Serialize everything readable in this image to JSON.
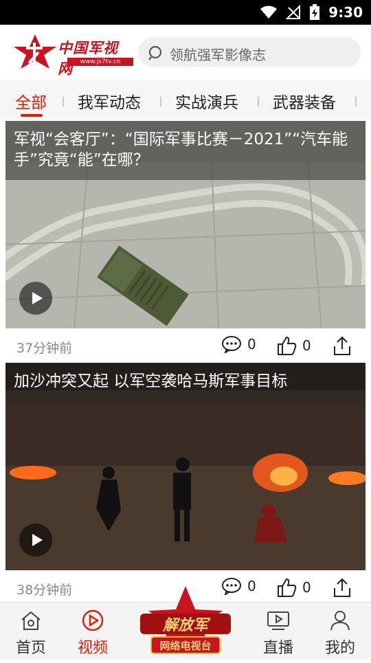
{
  "status_bar": {
    "time": "9:30"
  },
  "header": {
    "logo_text": "中国军视网",
    "logo_url": "www.js7tv.cn",
    "search_placeholder": "领航强军影像志"
  },
  "tabs": [
    {
      "label": "全部",
      "active": true
    },
    {
      "label": "我军动态",
      "active": false
    },
    {
      "label": "实战演兵",
      "active": false
    },
    {
      "label": "武器装备",
      "active": false
    }
  ],
  "feed": [
    {
      "title": "军视“会客厅”：“国际军事比赛－2021”“汽车能手”究竟“能”在哪？",
      "time": "37分钟前",
      "comments": "0",
      "likes": "0"
    },
    {
      "title": "加沙冲突又起 以军空袭哈马斯军事目标",
      "time": "38分钟前",
      "comments": "0",
      "likes": "0"
    }
  ],
  "bottom_nav": {
    "home": "首页",
    "video": "视频",
    "center_line1": "解放军",
    "center_line2": "网络电视台",
    "live": "直播",
    "mine": "我的"
  },
  "colors": {
    "accent": "#d81e06",
    "brand_red": "#c8141e"
  }
}
